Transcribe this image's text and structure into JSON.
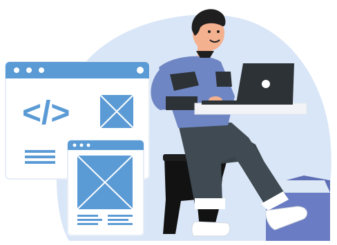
{
  "illustration": {
    "code_symbol": "</>",
    "colors": {
      "background_blob": "#d9e6f7",
      "window_frame": "#5b9bd5",
      "window_body": "#ffffff",
      "skin": "#f4b18f",
      "hair": "#1f1f1f",
      "sweater": "#6f86c4",
      "pants": "#39434a",
      "laptop": "#2d3236",
      "desk": "#f1f3f6",
      "stool": "#121212",
      "folder": "#5e6fb6",
      "shoes": "#ffffff"
    }
  }
}
